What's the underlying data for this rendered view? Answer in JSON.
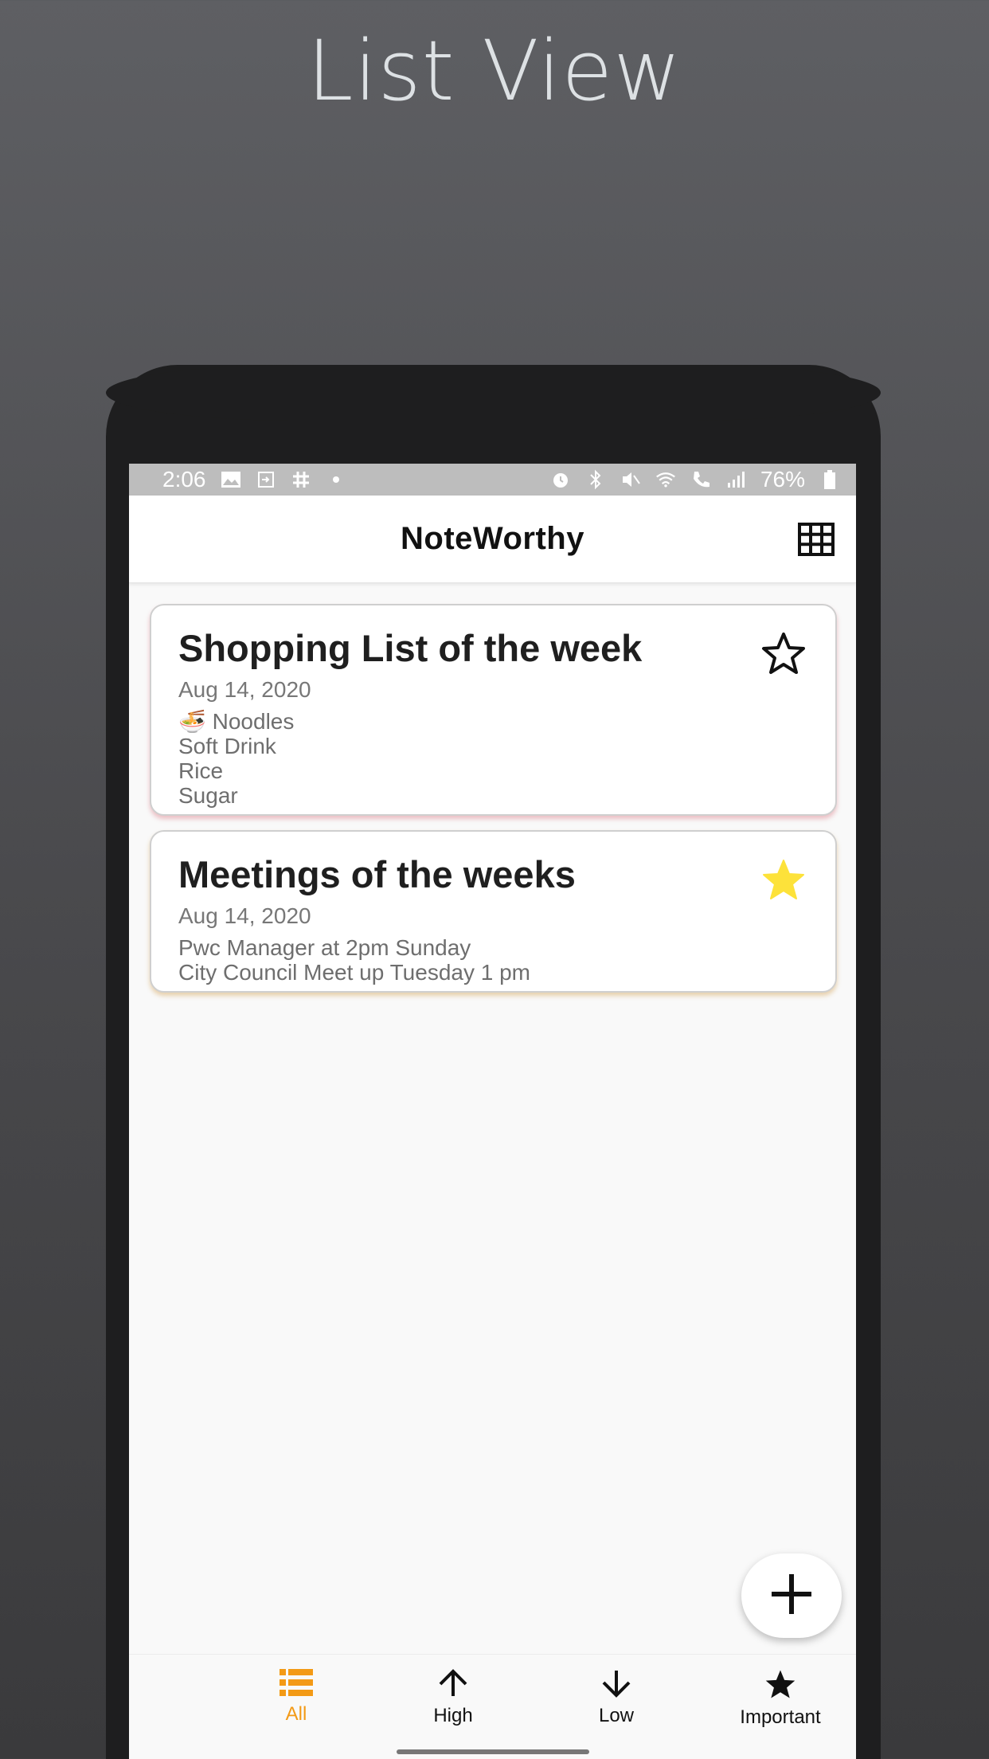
{
  "headline": "List View",
  "status_bar": {
    "time": "2:06",
    "battery": "76%",
    "left_icons": [
      "image-icon",
      "cast-icon",
      "slack-icon",
      "dot-icon"
    ],
    "right_icons": [
      "alarm-icon",
      "bluetooth-icon",
      "mute-icon",
      "wifi-icon",
      "wifi-call-icon",
      "signal-icon",
      "battery-icon"
    ]
  },
  "app_bar": {
    "title": "NoteWorthy",
    "action_icon": "grid-view-icon"
  },
  "notes": [
    {
      "title": "Shopping List of the week",
      "date": "Aug 14, 2020",
      "lines": [
        "🍜 Noodles",
        "Soft Drink",
        "Rice",
        "Sugar"
      ],
      "important": false,
      "accent": "#e08a95"
    },
    {
      "title": "Meetings of the weeks",
      "date": "Aug 14, 2020",
      "lines": [
        "Pwc Manager at 2pm Sunday",
        "City Council Meet up Tuesday 1 pm"
      ],
      "important": true,
      "accent": "#d8a860"
    }
  ],
  "fab": {
    "icon": "plus-icon"
  },
  "bottom_nav": [
    {
      "label": "All",
      "icon": "list-icon",
      "active": true
    },
    {
      "label": "High",
      "icon": "arrow-up-icon",
      "active": false
    },
    {
      "label": "Low",
      "icon": "arrow-down-icon",
      "active": false
    },
    {
      "label": "Important",
      "icon": "star-icon",
      "active": false
    }
  ],
  "colors": {
    "accent": "#f39a16",
    "star_filled": "#fde23a",
    "status_bar": "#bdbdbd"
  }
}
